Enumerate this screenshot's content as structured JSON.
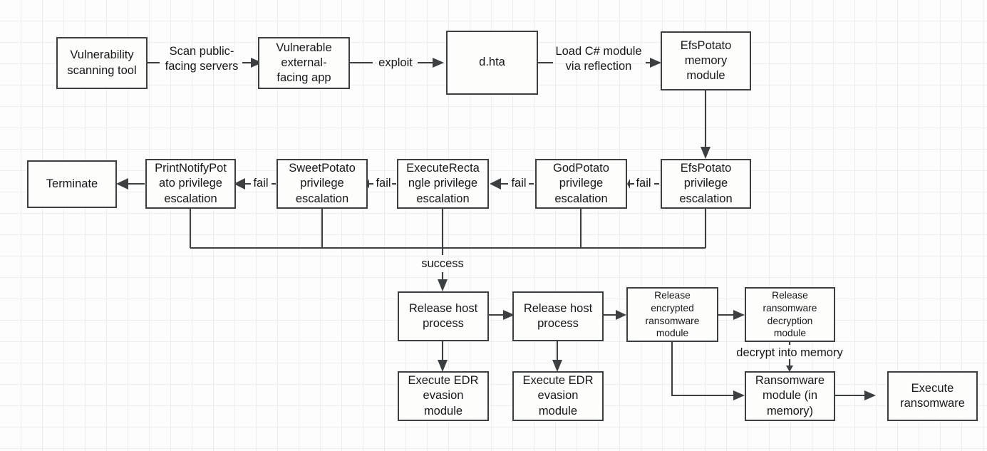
{
  "diagram": {
    "title": "Ransomware attack chain flowchart",
    "background": "#fdfdfd",
    "grid_color": "#ededed",
    "stroke_color": "#3c4043",
    "node_fill": "#fdfdfc",
    "nodes": [
      {
        "id": "vuln-scanner",
        "label": "Vulnerability\nscanning tool"
      },
      {
        "id": "vuln-app",
        "label": "Vulnerable\nexternal-\nfacing app"
      },
      {
        "id": "dhta",
        "label": "d.hta"
      },
      {
        "id": "efspotato-memory",
        "label": "EfsPotato\nmemory\nmodule"
      },
      {
        "id": "efspotato-privesc",
        "label": "EfsPotato\nprivilege\nescalation"
      },
      {
        "id": "godpotato-privesc",
        "label": "GodPotato\nprivilege\nescalation"
      },
      {
        "id": "executerectangle-privesc",
        "label": "ExecuteRecta\nngle privilege\nescalation"
      },
      {
        "id": "sweetpotato-privesc",
        "label": "SweetPotato\nprivilege\nescalation"
      },
      {
        "id": "printnotifypotato-privesc",
        "label": "PrintNotifyPot\nato privilege\nescalation"
      },
      {
        "id": "terminate",
        "label": "Terminate"
      },
      {
        "id": "release-host-1",
        "label": "Release host\nprocess"
      },
      {
        "id": "release-host-2",
        "label": "Release host\nprocess"
      },
      {
        "id": "release-encrypted",
        "label": "Release\nencrypted\nransomware\nmodule"
      },
      {
        "id": "release-decryption",
        "label": "Release\nransomware\ndecryption\nmodule"
      },
      {
        "id": "edr-evasion-1",
        "label": "Execute EDR\nevasion\nmodule"
      },
      {
        "id": "edr-evasion-2",
        "label": "Execute EDR\nevasion\nmodule"
      },
      {
        "id": "ransomware-module",
        "label": "Ransomware\nmodule (in\nmemory)"
      },
      {
        "id": "execute-ransomware",
        "label": "Execute\nransomware"
      }
    ],
    "edge_labels": [
      {
        "id": "scan-servers",
        "text": "Scan public-\nfacing servers"
      },
      {
        "id": "exploit",
        "text": "exploit"
      },
      {
        "id": "load-csharp",
        "text": "Load C# module\nvia reflection"
      },
      {
        "id": "fail-1",
        "text": "fail"
      },
      {
        "id": "fail-2",
        "text": "fail"
      },
      {
        "id": "fail-3",
        "text": "fail"
      },
      {
        "id": "fail-4",
        "text": "fail"
      },
      {
        "id": "success",
        "text": "success"
      },
      {
        "id": "decrypt-memory",
        "text": "decrypt into memory"
      }
    ]
  }
}
